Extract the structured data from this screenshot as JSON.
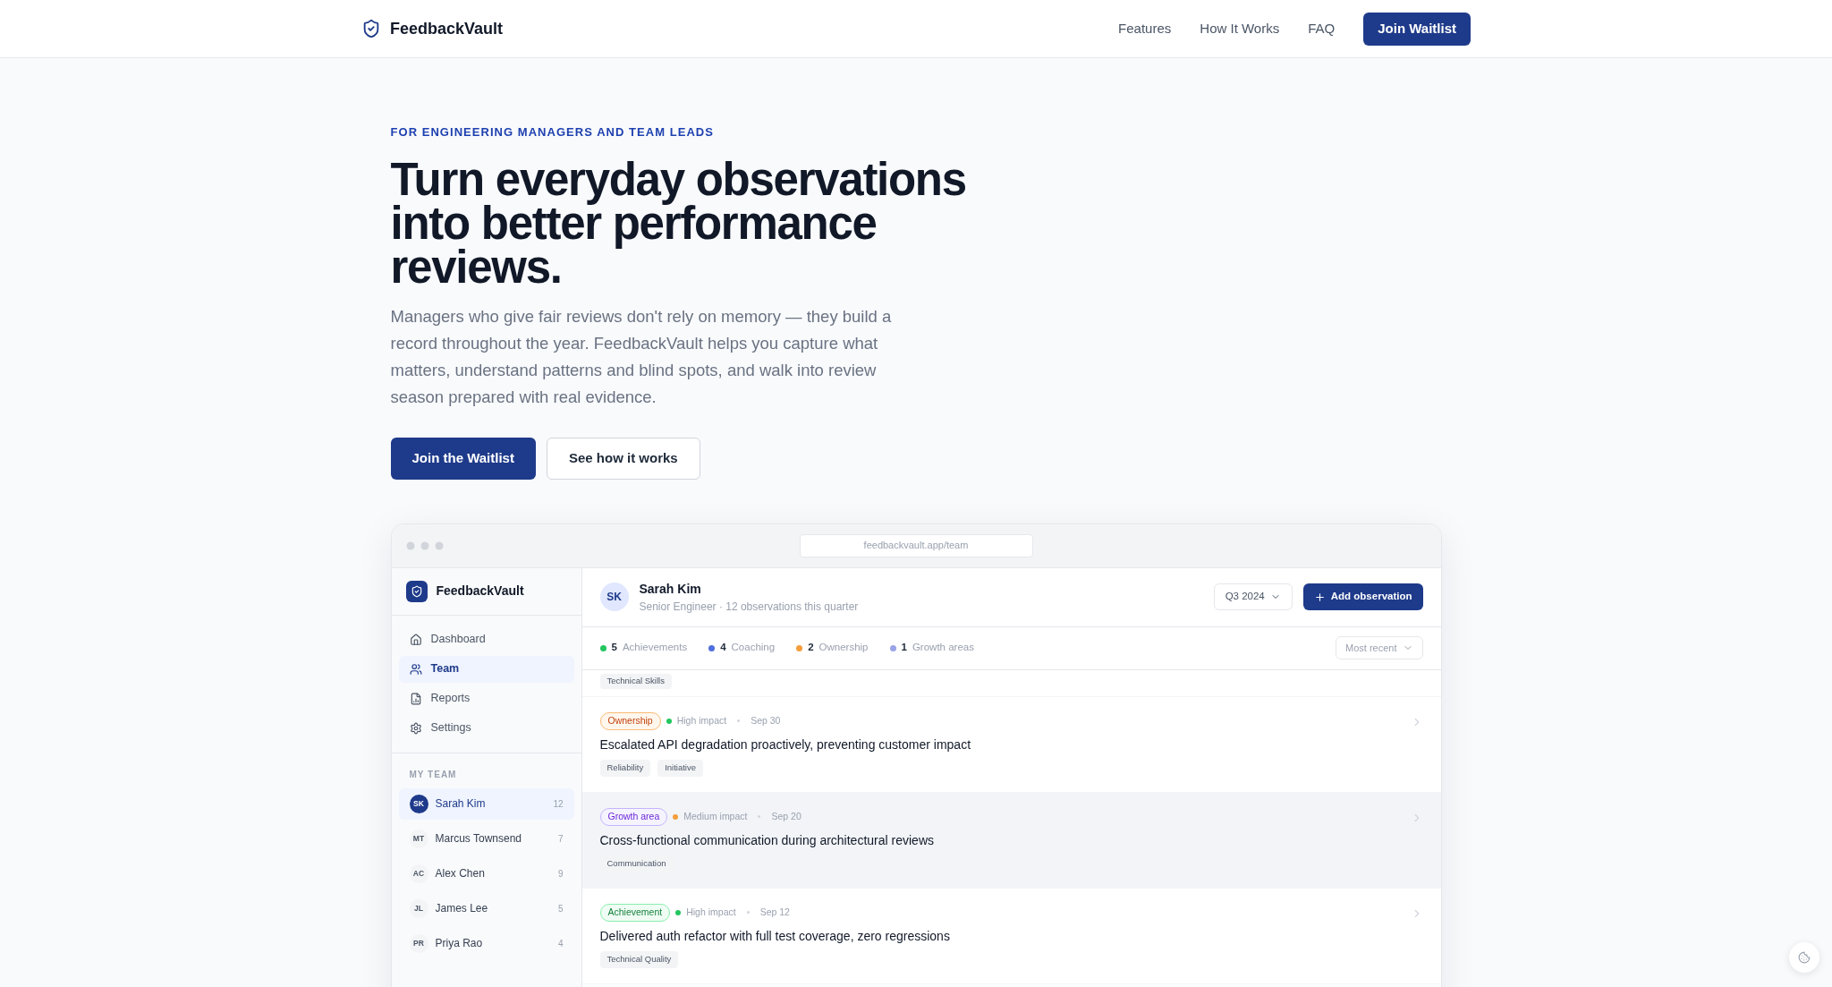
{
  "header": {
    "brand": "FeedbackVault",
    "nav": [
      {
        "label": "Features"
      },
      {
        "label": "How It Works"
      },
      {
        "label": "FAQ"
      }
    ],
    "cta": "Join Waitlist"
  },
  "hero": {
    "eyebrow": "FOR ENGINEERING MANAGERS AND TEAM LEADS",
    "title": "Turn everyday observations into better performance reviews.",
    "description": "Managers who give fair reviews don't rely on memory — they build a record throughout the year. FeedbackVault helps you capture what matters, understand patterns and blind spots, and walk into review season prepared with real evidence.",
    "buttons": [
      {
        "label": "Join the Waitlist",
        "kind": "primary"
      },
      {
        "label": "See how it works",
        "kind": "secondary"
      }
    ]
  },
  "app_preview": {
    "url": "feedbackvault.app/team",
    "sidebar": {
      "brand": "FeedbackVault",
      "nav": [
        {
          "label": "Dashboard",
          "selected": false
        },
        {
          "label": "Team",
          "selected": true
        },
        {
          "label": "Reports",
          "selected": false
        },
        {
          "label": "Settings",
          "selected": false
        }
      ],
      "team_heading": "MY TEAM",
      "members": [
        {
          "initials": "SK",
          "name": "Sarah Kim",
          "count": "12",
          "selected": true
        },
        {
          "initials": "MT",
          "name": "Marcus Townsend",
          "count": "7",
          "selected": false
        },
        {
          "initials": "AC",
          "name": "Alex Chen",
          "count": "9",
          "selected": false
        },
        {
          "initials": "JL",
          "name": "James Lee",
          "count": "5",
          "selected": false
        },
        {
          "initials": "PR",
          "name": "Priya Rao",
          "count": "4",
          "selected": false
        }
      ]
    },
    "profile": {
      "initials": "SK",
      "name": "Sarah Kim",
      "subtitle": "Senior Engineer · 12 observations this quarter"
    },
    "period": "Q3 2024",
    "add_button": "Add observation",
    "summary": [
      {
        "count": "5",
        "label": "Achievements",
        "color": "#22c55e"
      },
      {
        "count": "4",
        "label": "Coaching",
        "color": "#4f6fdc"
      },
      {
        "count": "2",
        "label": "Ownership",
        "color": "#f59e3b"
      },
      {
        "count": "1",
        "label": "Growth areas",
        "color": "#9aa3e6"
      }
    ],
    "sort": "Most recent",
    "scrolled_tags": [
      "Technical Skills"
    ],
    "observations": [
      {
        "kind": "ownership",
        "category": "Ownership",
        "impact": {
          "label": "High impact",
          "color": "#22c55e"
        },
        "date": "Sep 30",
        "title": "Escalated API degradation proactively, preventing customer impact",
        "tags": [
          "Reliability",
          "Initiative"
        ],
        "selected": false
      },
      {
        "kind": "growth",
        "category": "Growth area",
        "impact": {
          "label": "Medium impact",
          "color": "#f59e3b"
        },
        "date": "Sep 20",
        "title": "Cross-functional communication during architectural reviews",
        "tags": [
          "Communication"
        ],
        "selected": true
      },
      {
        "kind": "achievement",
        "category": "Achievement",
        "impact": {
          "label": "High impact",
          "color": "#22c55e"
        },
        "date": "Sep 12",
        "title": "Delivered auth refactor with full test coverage, zero regressions",
        "tags": [
          "Technical Quality"
        ],
        "selected": false
      }
    ]
  }
}
